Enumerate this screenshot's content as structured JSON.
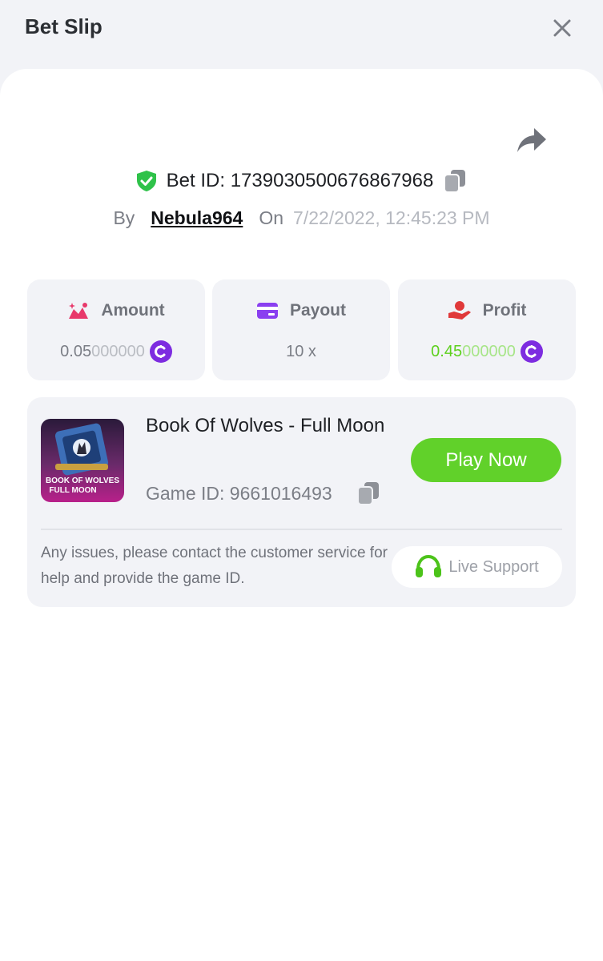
{
  "header": {
    "title": "Bet Slip"
  },
  "bet": {
    "id_text": "Bet ID: 1739030500676867968",
    "by_label": "By",
    "username": "Nebula964",
    "on_label": "On",
    "timestamp": "7/22/2022, 12:45:23 PM"
  },
  "stats": {
    "amount": {
      "label": "Amount",
      "value_main": "0.05",
      "value_trailing": "000000"
    },
    "payout": {
      "label": "Payout",
      "value": "10 x"
    },
    "profit": {
      "label": "Profit",
      "value_main": "0.45",
      "value_trailing": "000000"
    }
  },
  "game": {
    "title": "Book Of Wolves - Full Moon",
    "thumb_line1": "BOOK OF WOLVES",
    "thumb_line2": "FULL MOON",
    "id_text": "Game ID: 9661016493",
    "play_label": "Play Now",
    "help_text": "Any issues, please contact the customer service for help and provide the game ID.",
    "support_label": "Live Support"
  },
  "colors": {
    "accent_green": "#61d12a",
    "coin_purple": "#7d2ce0",
    "amount_icon": "#e8396b",
    "payout_icon": "#8a3ff0",
    "profit_icon": "#e0393a",
    "shield_green": "#2fc24a"
  },
  "icons": {
    "close": "close-icon",
    "share": "share-icon",
    "shield": "shield-check-icon",
    "copy": "copy-icon",
    "amount": "amount-icon",
    "payout": "card-icon",
    "profit": "hand-coin-icon",
    "coin": "coin-icon",
    "headset": "headset-icon"
  }
}
